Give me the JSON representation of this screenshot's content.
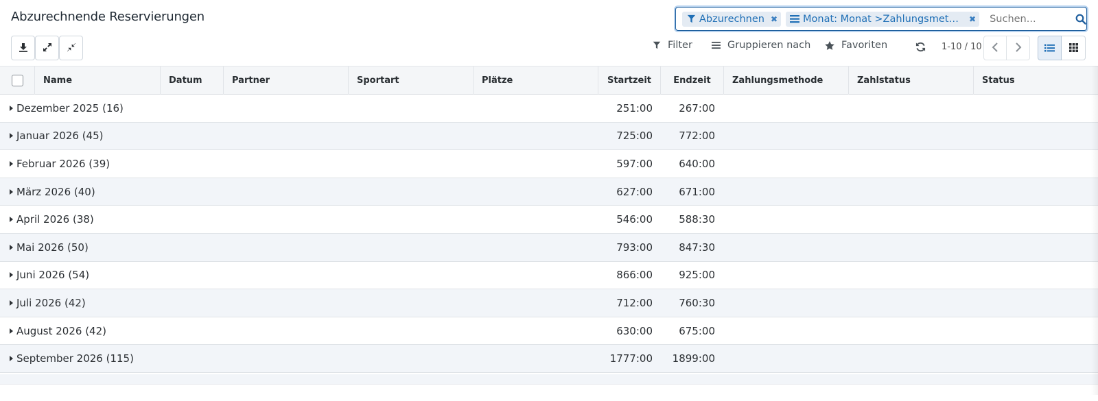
{
  "page": {
    "title": "Abzurechnende Reservierungen"
  },
  "search": {
    "facets": [
      {
        "label": "Abzurechnen",
        "icon": "filter-icon"
      },
      {
        "label": "Monat: Monat  >Zahlungsmetho…",
        "icon": "group-by-icon"
      }
    ],
    "placeholder": "Suchen..."
  },
  "controls": {
    "filter_label": "Filter",
    "groupby_label": "Gruppieren nach",
    "favorites_label": "Favoriten",
    "pager_text": "1-10 / 10"
  },
  "table": {
    "columns": [
      "Name",
      "Datum",
      "Partner",
      "Sportart",
      "Plätze",
      "Startzeit",
      "Endzeit",
      "Zahlungsmethode",
      "Zahlstatus",
      "Status"
    ],
    "groups": [
      {
        "label": "Dezember 2025 (16)",
        "start": "251:00",
        "end": "267:00"
      },
      {
        "label": "Januar 2026 (45)",
        "start": "725:00",
        "end": "772:00"
      },
      {
        "label": "Februar 2026 (39)",
        "start": "597:00",
        "end": "640:00"
      },
      {
        "label": "März 2026 (40)",
        "start": "627:00",
        "end": "671:00"
      },
      {
        "label": "April 2026 (38)",
        "start": "546:00",
        "end": "588:30"
      },
      {
        "label": "Mai 2026 (50)",
        "start": "793:00",
        "end": "847:30"
      },
      {
        "label": "Juni 2026 (54)",
        "start": "866:00",
        "end": "925:00"
      },
      {
        "label": "Juli 2026 (42)",
        "start": "712:00",
        "end": "760:30"
      },
      {
        "label": "August 2026 (42)",
        "start": "630:00",
        "end": "675:00"
      },
      {
        "label": "September 2026 (115)",
        "start": "1777:00",
        "end": "1899:00"
      }
    ]
  },
  "colors": {
    "accent": "#1f6fb6",
    "facet_bg": "#e4ebf3",
    "alt_row": "#f2f5f9"
  }
}
